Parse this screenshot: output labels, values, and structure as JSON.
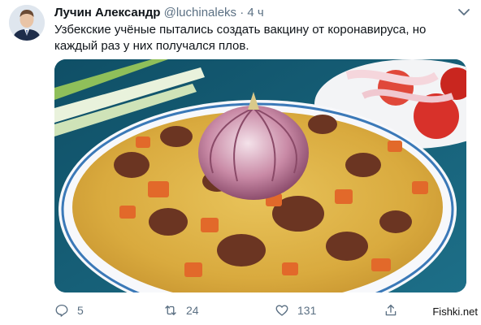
{
  "author": {
    "name": "Лучин Александр",
    "handle": "@luchinaleks",
    "separator": "·",
    "time": "4 ч",
    "avatar_icon": "avatar-icon"
  },
  "tweet": {
    "text": "Узбекские учёные пытались создать вакцину от коронавируса, но каждый раз у них получался плов."
  },
  "image": {
    "subject": "plov-photo"
  },
  "actions": {
    "replies": "5",
    "retweets": "24",
    "likes": "131"
  },
  "watermark": {
    "text": "Fishki.net"
  },
  "colors": {
    "text": "#0f1419",
    "muted": "#5b7083",
    "background": "#ffffff"
  }
}
